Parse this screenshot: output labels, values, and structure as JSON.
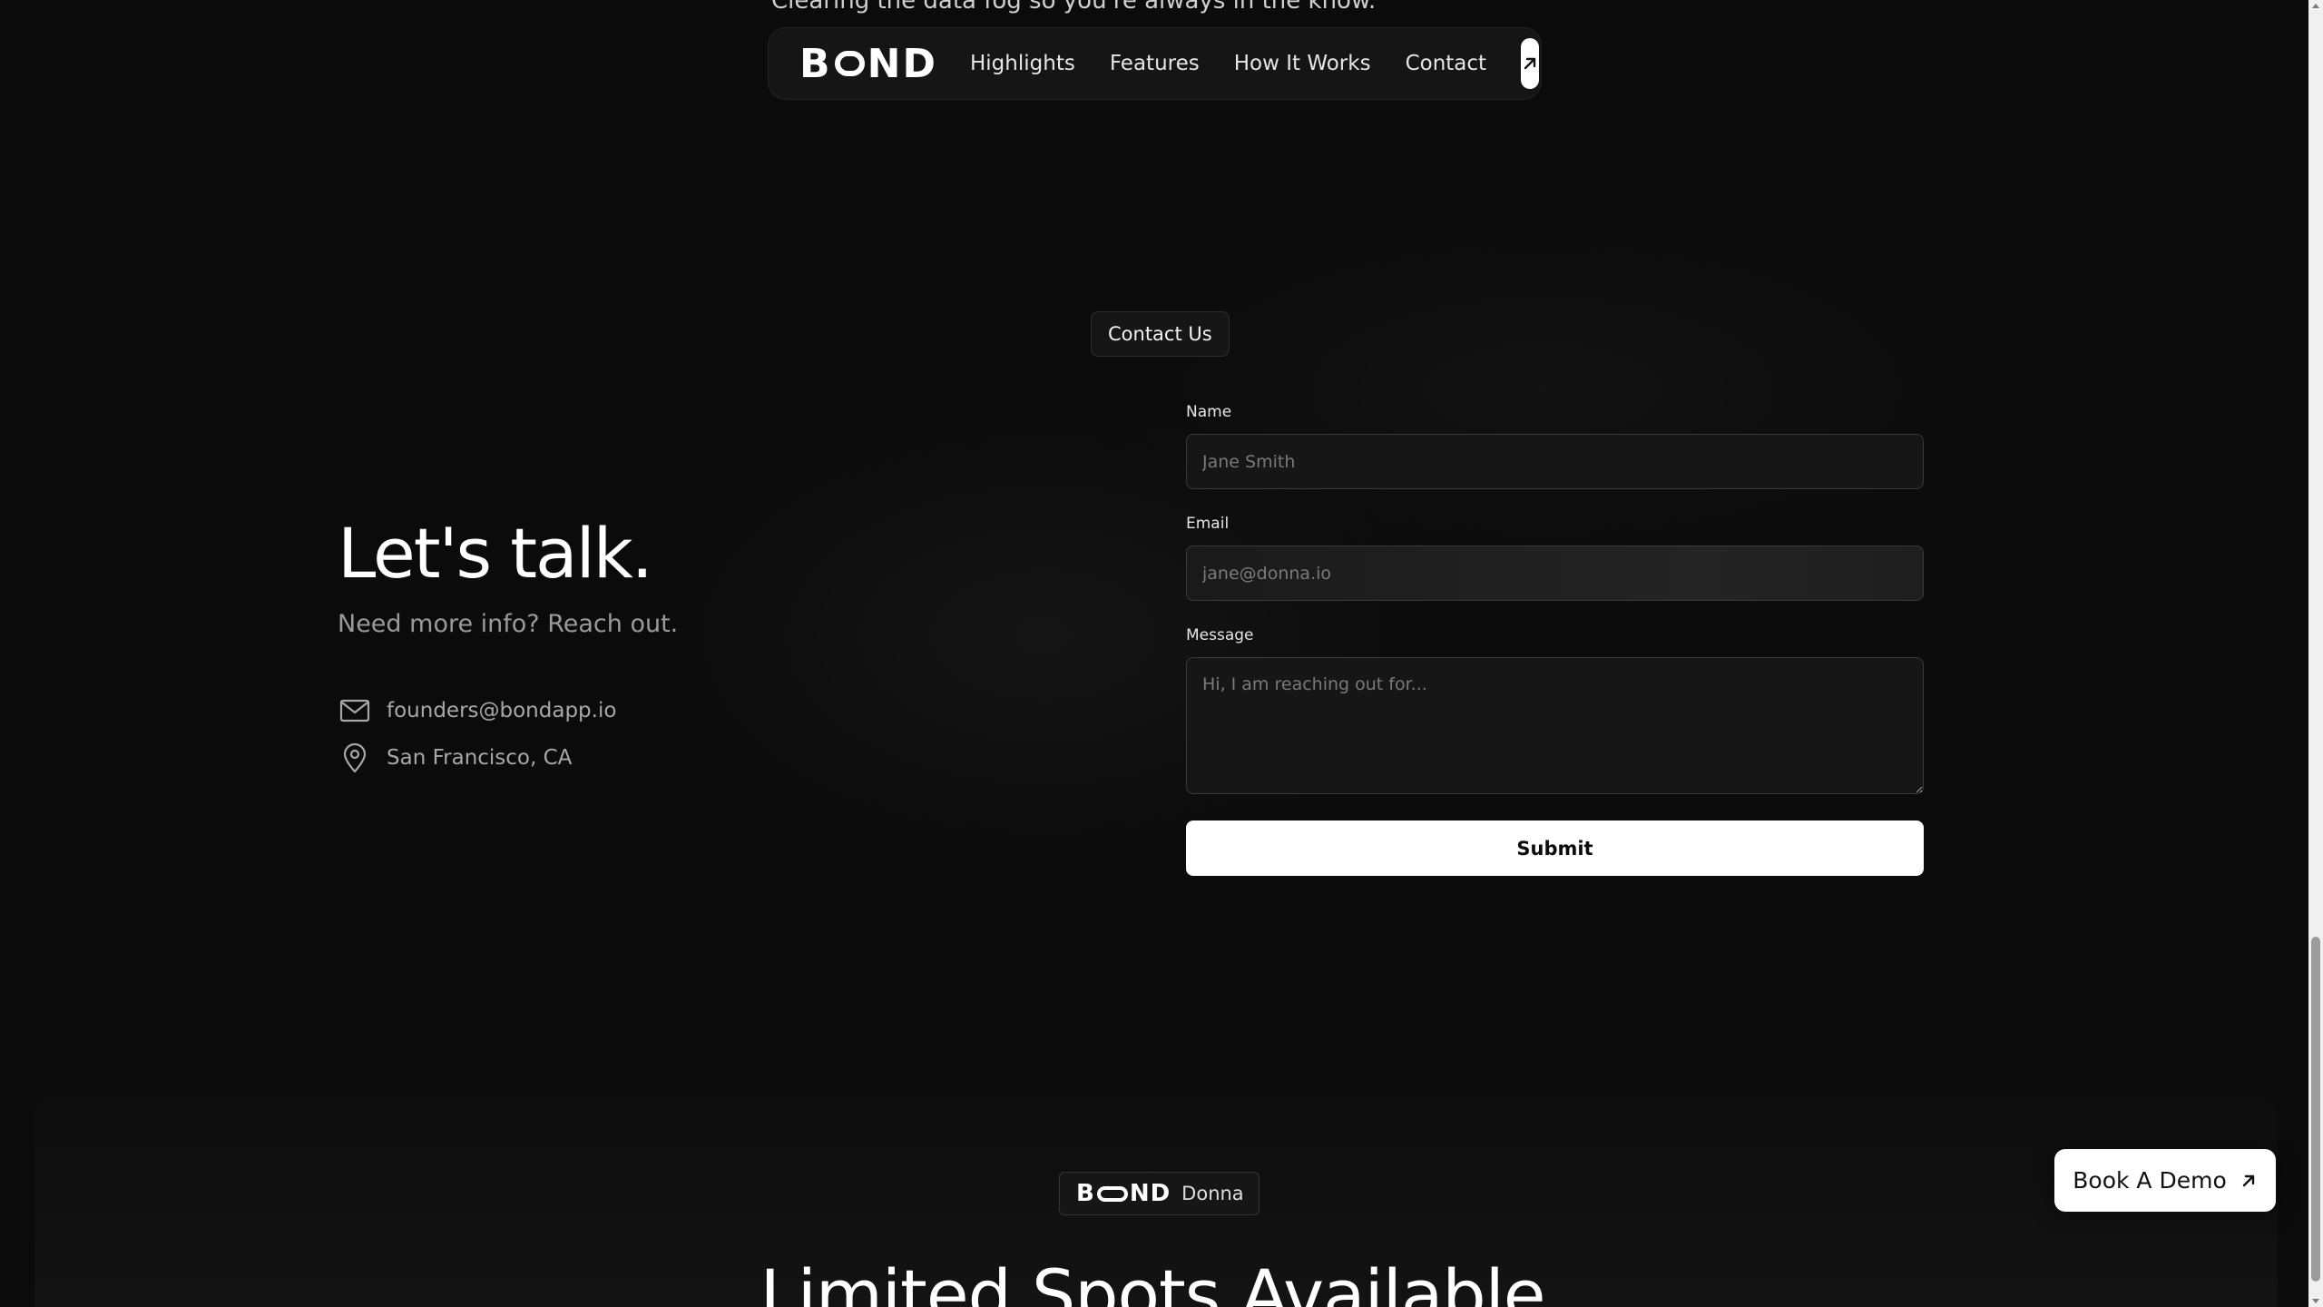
{
  "top_tagline": "Clearing the data fog so you're always in the know.",
  "nav": {
    "logo_left": "B",
    "logo_right": "ND",
    "links": [
      "Highlights",
      "Features",
      "How It Works",
      "Contact"
    ],
    "cta_icon": "arrow-up-right-icon"
  },
  "contact_section": {
    "pill_label": "Contact Us",
    "heading": "Let's talk.",
    "subtitle": "Need more info? Reach out.",
    "email": "founders@bondapp.io",
    "email_icon": "mail-icon",
    "location": "San Francisco, CA",
    "location_icon": "map-pin-icon"
  },
  "form": {
    "name_label": "Name",
    "name_placeholder": "Jane Smith",
    "email_label": "Email",
    "email_placeholder": "jane@donna.io",
    "message_label": "Message",
    "message_placeholder": "Hi, I am reaching out for...",
    "submit_label": "Submit"
  },
  "bottom": {
    "badge_logo_left": "B",
    "badge_logo_right": "ND",
    "badge_label": "Donna",
    "heading": "Limited Spots Available"
  },
  "floating_cta": {
    "label": "Book A Demo",
    "icon": "arrow-up-right-icon"
  },
  "colors": {
    "background": "#0b0b0b",
    "accent": "#ffffff",
    "muted_text": "#9a9a9a"
  }
}
